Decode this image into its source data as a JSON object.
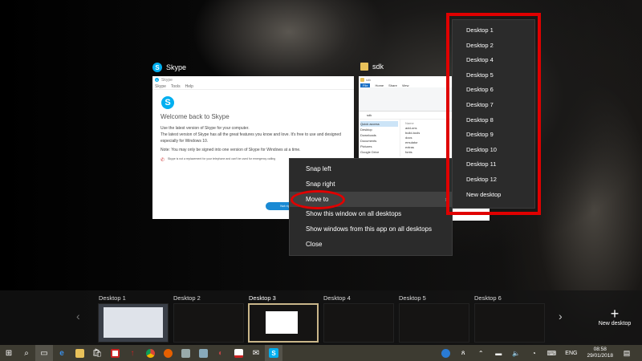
{
  "windows": [
    {
      "title": "Skype",
      "icon": "skype-icon"
    },
    {
      "title": "sdk",
      "icon": "folder-icon"
    }
  ],
  "skype": {
    "window_title": "Skype",
    "menu": [
      "Skype",
      "Tools",
      "Help"
    ],
    "heading": "Welcome back to Skype",
    "p1": "Use the latest version of Skype for your computer.",
    "p2": "The latest version of Skype has all the great features you know and love. It's free to use and designed especially for Windows 10.",
    "p3": "Note: You may only be signed into one version of Skype for Windows at a time.",
    "warning": "Skype is not a replacement for your telephone and can't be used for emergency calling",
    "button": "Not right now"
  },
  "sdk": {
    "path": "sdk",
    "tabs": [
      "File",
      "Home",
      "Share",
      "View"
    ],
    "nav": [
      "Quick access",
      "Desktop",
      "Downloads",
      "Documents",
      "Pictures",
      "Google Drive"
    ],
    "files_header": "Name",
    "files": [
      "add-ons",
      "build-tools",
      "docs",
      "emulator",
      "extras",
      "fonts"
    ]
  },
  "context_menu": [
    "Snap left",
    "Snap right",
    "Move to",
    "Show this window on all desktops",
    "Show windows from this app on all desktops",
    "Close"
  ],
  "submenu": [
    "Desktop 1",
    "Desktop 2",
    "Desktop 4",
    "Desktop 5",
    "Desktop 6",
    "Desktop 7",
    "Desktop 8",
    "Desktop 9",
    "Desktop 10",
    "Desktop 11",
    "Desktop 12",
    "New desktop"
  ],
  "desktops": [
    "Desktop 1",
    "Desktop 2",
    "Desktop 3",
    "Desktop 4",
    "Desktop 5",
    "Desktop 6"
  ],
  "active_desktop": "Desktop 3",
  "new_desktop": "New desktop",
  "tray": {
    "lang": "ENG",
    "time": "08:58",
    "date": "29/01/2018"
  },
  "colors": {
    "highlight": "#e00000",
    "accent": "#00aff0",
    "taskbar": "#3d3b31"
  }
}
